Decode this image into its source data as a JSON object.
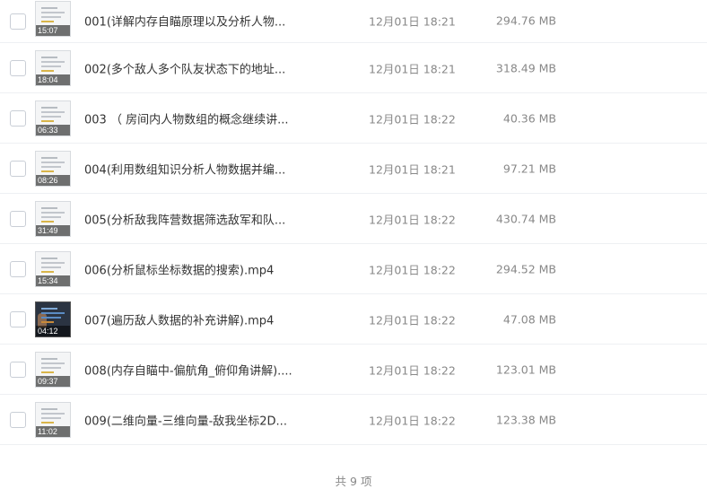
{
  "files": [
    {
      "name": "001(详解内存自瞄原理以及分析人物...",
      "date": "12月01日 18:21",
      "size": "294.76 MB",
      "duration": "15:07",
      "thumb": "doc"
    },
    {
      "name": "002(多个敌人多个队友状态下的地址...",
      "date": "12月01日 18:21",
      "size": "318.49 MB",
      "duration": "18:04",
      "thumb": "doc"
    },
    {
      "name": "003 （ 房间内人物数组的概念继续讲...",
      "date": "12月01日 18:22",
      "size": "40.36 MB",
      "duration": "06:33",
      "thumb": "doc"
    },
    {
      "name": "004(利用数组知识分析人物数据并编...",
      "date": "12月01日 18:21",
      "size": "97.21 MB",
      "duration": "08:26",
      "thumb": "doc"
    },
    {
      "name": "005(分析敌我阵营数据筛选敌军和队...",
      "date": "12月01日 18:22",
      "size": "430.74 MB",
      "duration": "31:49",
      "thumb": "doc"
    },
    {
      "name": "006(分析鼠标坐标数据的搜索).mp4",
      "date": "12月01日 18:22",
      "size": "294.52 MB",
      "duration": "15:34",
      "thumb": "doc"
    },
    {
      "name": "007(遍历敌人数据的补充讲解).mp4",
      "date": "12月01日 18:22",
      "size": "47.08 MB",
      "duration": "04:12",
      "thumb": "dark"
    },
    {
      "name": "008(内存自瞄中-偏航角_俯仰角讲解)....",
      "date": "12月01日 18:22",
      "size": "123.01 MB",
      "duration": "09:37",
      "thumb": "doc"
    },
    {
      "name": "009(二维向量-三维向量-敌我坐标2D...",
      "date": "12月01日 18:22",
      "size": "123.38 MB",
      "duration": "11:02",
      "thumb": "doc"
    }
  ],
  "footer": {
    "total_label": "共 9 项"
  }
}
